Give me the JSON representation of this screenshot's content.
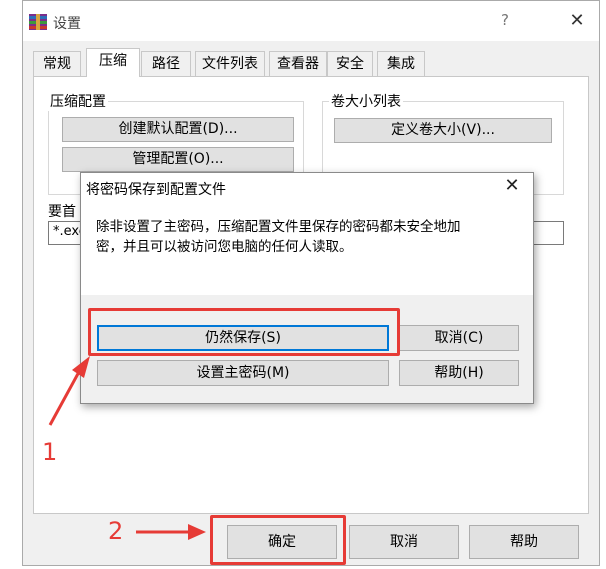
{
  "window": {
    "title": "设置",
    "help_glyph": "?",
    "close_glyph": "✕"
  },
  "tabs": [
    {
      "label": "常规"
    },
    {
      "label": "压缩"
    },
    {
      "label": "路径"
    },
    {
      "label": "文件列表"
    },
    {
      "label": "查看器"
    },
    {
      "label": "安全"
    },
    {
      "label": "集成"
    }
  ],
  "compression_profiles": {
    "group_label": "压缩配置",
    "create_default_label": "创建默认配置(D)...",
    "manage_label": "管理配置(O)..."
  },
  "volume_sizes": {
    "group_label": "卷大小列表",
    "define_label": "定义卷大小(V)..."
  },
  "partial": {
    "label_fragment": "要首",
    "field_fragment": "*.exe"
  },
  "dialog": {
    "title": "将密码保存到配置文件",
    "close_glyph": "✕",
    "message_line1": "除非设置了主密码，压缩配置文件里保存的密码都未安全地加",
    "message_line2": "密，并且可以被访问您电脑的任何人读取。",
    "save_anyway_label": "仍然保存(S)",
    "cancel_label": "取消(C)",
    "set_master_password_label": "设置主密码(M)",
    "help_label": "帮助(H)"
  },
  "bottom": {
    "ok_label": "确定",
    "cancel_label": "取消",
    "help_label": "帮助"
  },
  "annotations": {
    "step1": "1",
    "step2": "2",
    "color": "#e63b36"
  }
}
